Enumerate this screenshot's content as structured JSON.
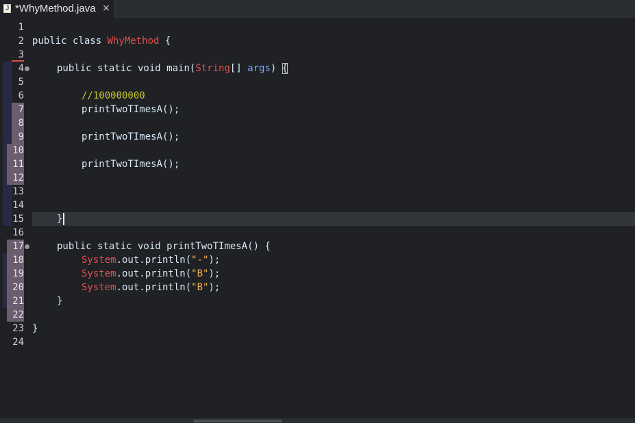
{
  "tab": {
    "file_icon_label": "J",
    "title": "*WhyMethod.java",
    "close_glyph": "×"
  },
  "line_numbers": [
    "1",
    "2",
    "3",
    "4",
    "5",
    "6",
    "7",
    "8",
    "9",
    "10",
    "11",
    "12",
    "13",
    "14",
    "15",
    "16",
    "17",
    "18",
    "19",
    "20",
    "21",
    "22",
    "23",
    "24"
  ],
  "code": {
    "l2": {
      "kw": "public class ",
      "cls": "WhyMethod",
      "rest": " {"
    },
    "l4": {
      "kw": "public static void ",
      "fn": "main(",
      "cls": "String",
      "mid": "[] ",
      "par": "args",
      "tail": ") ",
      "brace": "{"
    },
    "l6": {
      "cmt": "//100000000"
    },
    "l7": "printTwoTImesA();",
    "l9": "printTwoTImesA();",
    "l11": "printTwoTImesA();",
    "l15": "}",
    "l17": {
      "kw": "public static void ",
      "fn": "printTwoTImesA() {"
    },
    "l18": {
      "cls": "System",
      "mid": ".out.println(",
      "str": "\"-\"",
      "tail": ");"
    },
    "l19": {
      "cls": "System",
      "mid": ".out.println(",
      "str": "\"B\"",
      "tail": ");"
    },
    "l20": {
      "cls": "System",
      "mid": ".out.println(",
      "str": "\"B\"",
      "tail": ");"
    },
    "l21": "}",
    "l23": "}"
  },
  "colors": {
    "background": "#1f2124",
    "keyword": "#d9e8f7",
    "class_name": "#e34f4f",
    "parameter": "#79abff",
    "comment": "#c8c832",
    "string": "#f3b24c",
    "modified_line_marker": "#6b5c6e",
    "current_line": "#32363b"
  }
}
